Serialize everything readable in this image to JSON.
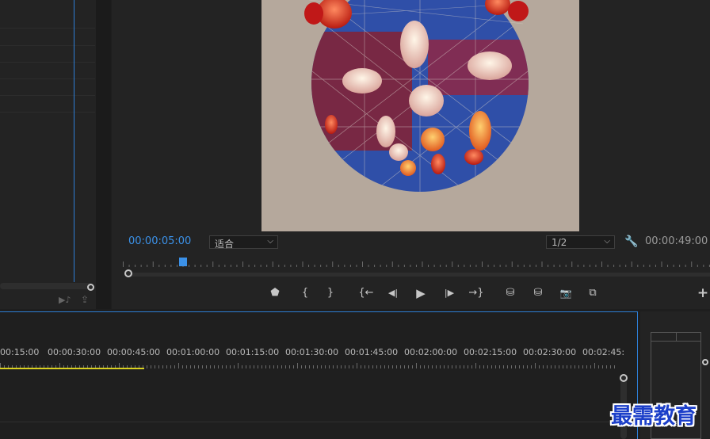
{
  "program_monitor": {
    "current_timecode": "00:00:05:00",
    "zoom_select": "适合",
    "resolution_select": "1/2",
    "duration_timecode": "00:00:49:00",
    "controls": [
      {
        "icon": "marker-icon",
        "glyph": "⬟"
      },
      {
        "icon": "mark-in-icon",
        "glyph": "{"
      },
      {
        "icon": "mark-out-icon",
        "glyph": "}"
      },
      {
        "icon": "go-to-in-icon",
        "glyph": "{←"
      },
      {
        "icon": "step-back-icon",
        "glyph": "◀|"
      },
      {
        "icon": "play-icon",
        "glyph": "▶"
      },
      {
        "icon": "step-forward-icon",
        "glyph": "|▶"
      },
      {
        "icon": "go-to-out-icon",
        "glyph": "→}"
      },
      {
        "icon": "lift-icon",
        "glyph": "⛁"
      },
      {
        "icon": "extract-icon",
        "glyph": "⛁"
      },
      {
        "icon": "export-frame-icon",
        "glyph": "📷"
      },
      {
        "icon": "compare-view-icon",
        "glyph": "⧉"
      }
    ],
    "add_button": "+"
  },
  "timeline": {
    "time_labels": [
      "00:15:00",
      "00:00:30:00",
      "00:00:45:00",
      "00:01:00:00",
      "00:01:15:00",
      "00:01:30:00",
      "00:01:45:00",
      "00:02:00:00",
      "00:02:15:00",
      "00:02:30:00",
      "00:02:45:"
    ]
  },
  "watermark": "最需教育",
  "colors": {
    "accent_blue": "#3b91e8",
    "work_area_yellow": "#d8d020",
    "panel_bg": "#232323"
  }
}
